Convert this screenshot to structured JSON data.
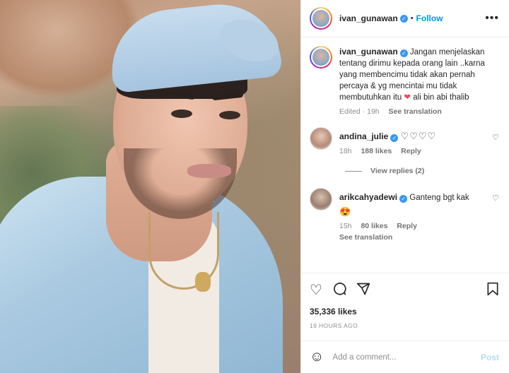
{
  "post": {
    "username": "ivan_gunawan",
    "follow_label": "Follow",
    "caption": "Jangan menjelaskan tentang dirimu kepada orang lain ..karna yang membencimu tidak akan pernah percaya & yg mencintai mu tidak membutuhkan itu",
    "caption_tail": " ali bin abi thalib",
    "edited_time": "Edited · 19h",
    "see_translation": "See translation",
    "likes": "35,336 likes",
    "date": "19 HOURS AGO"
  },
  "comments": [
    {
      "username": "andina_julie",
      "text": "♡♡♡♡",
      "time": "18h",
      "likes": "188 likes",
      "reply": "Reply",
      "view_replies": "View replies (2)"
    },
    {
      "username": "arikcahyadewi",
      "text": "Ganteng bgt kak",
      "emoji": "😍",
      "time": "15h",
      "likes": "80 likes",
      "reply": "Reply",
      "see_translation": "See translation"
    }
  ],
  "composer": {
    "placeholder": "Add a comment...",
    "post_label": "Post"
  },
  "icons": {
    "more": "more-icon",
    "heart": "heart-icon",
    "comment": "comment-icon",
    "share": "share-icon",
    "bookmark": "bookmark-icon",
    "emoji": "emoji-icon",
    "verified": "verified-icon"
  },
  "colors": {
    "accent": "#0095f6",
    "verified": "#3897f0",
    "muted": "#8e8e8e"
  }
}
